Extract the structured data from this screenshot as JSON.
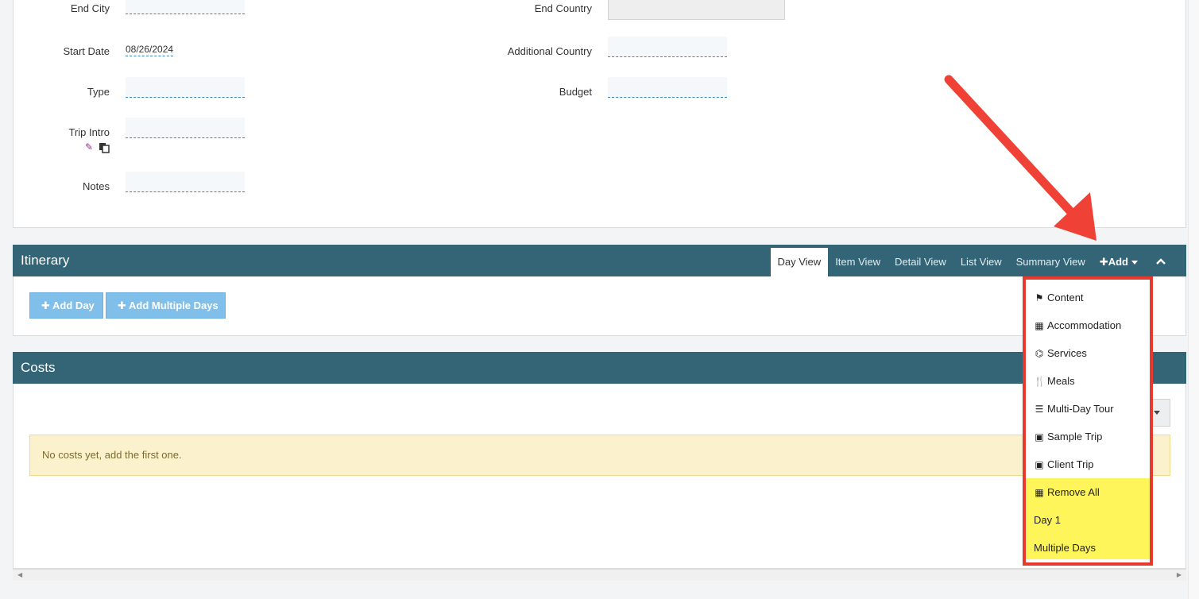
{
  "form": {
    "end_city_label": "End City",
    "end_country_label": "End Country",
    "start_date_label": "Start Date",
    "start_date_value": "08/26/2024",
    "additional_country_label": "Additional Country",
    "type_label": "Type",
    "budget_label": "Budget",
    "trip_intro_label": "Trip Intro",
    "notes_label": "Notes"
  },
  "itinerary": {
    "title": "Itinerary",
    "tabs": [
      {
        "label": "Day View",
        "active": true
      },
      {
        "label": "Item View",
        "active": false
      },
      {
        "label": "Detail View",
        "active": false
      },
      {
        "label": "List View",
        "active": false
      },
      {
        "label": "Summary View",
        "active": false
      }
    ],
    "add_label": "Add",
    "add_day_label": "Add Day",
    "add_multiple_days_label": "Add Multiple Days",
    "menu_items": [
      {
        "label": "Content",
        "icon": "flag-icon",
        "highlighted": false
      },
      {
        "label": "Accommodation",
        "icon": "building-icon",
        "highlighted": false
      },
      {
        "label": "Services",
        "icon": "binoculars-icon",
        "highlighted": false
      },
      {
        "label": "Meals",
        "icon": "utensils-icon",
        "highlighted": false
      },
      {
        "label": "Multi-Day Tour",
        "icon": "list-icon",
        "highlighted": false
      },
      {
        "label": "Sample Trip",
        "icon": "suitcase-icon",
        "highlighted": false
      },
      {
        "label": "Client Trip",
        "icon": "suitcase-icon",
        "highlighted": false
      },
      {
        "label": "Remove All",
        "icon": "building-icon",
        "highlighted": true
      },
      {
        "label": "Day 1",
        "icon": "",
        "highlighted": true
      },
      {
        "label": "Multiple Days",
        "icon": "",
        "highlighted": true
      }
    ]
  },
  "costs": {
    "title": "Costs",
    "empty_message": "No costs yet, add the first one."
  },
  "colors": {
    "header_bar": "#336577",
    "menu_border": "#e8392f",
    "highlight": "#fef55a",
    "button": "#7fbfea",
    "alert_bg": "#fbf1cd"
  }
}
